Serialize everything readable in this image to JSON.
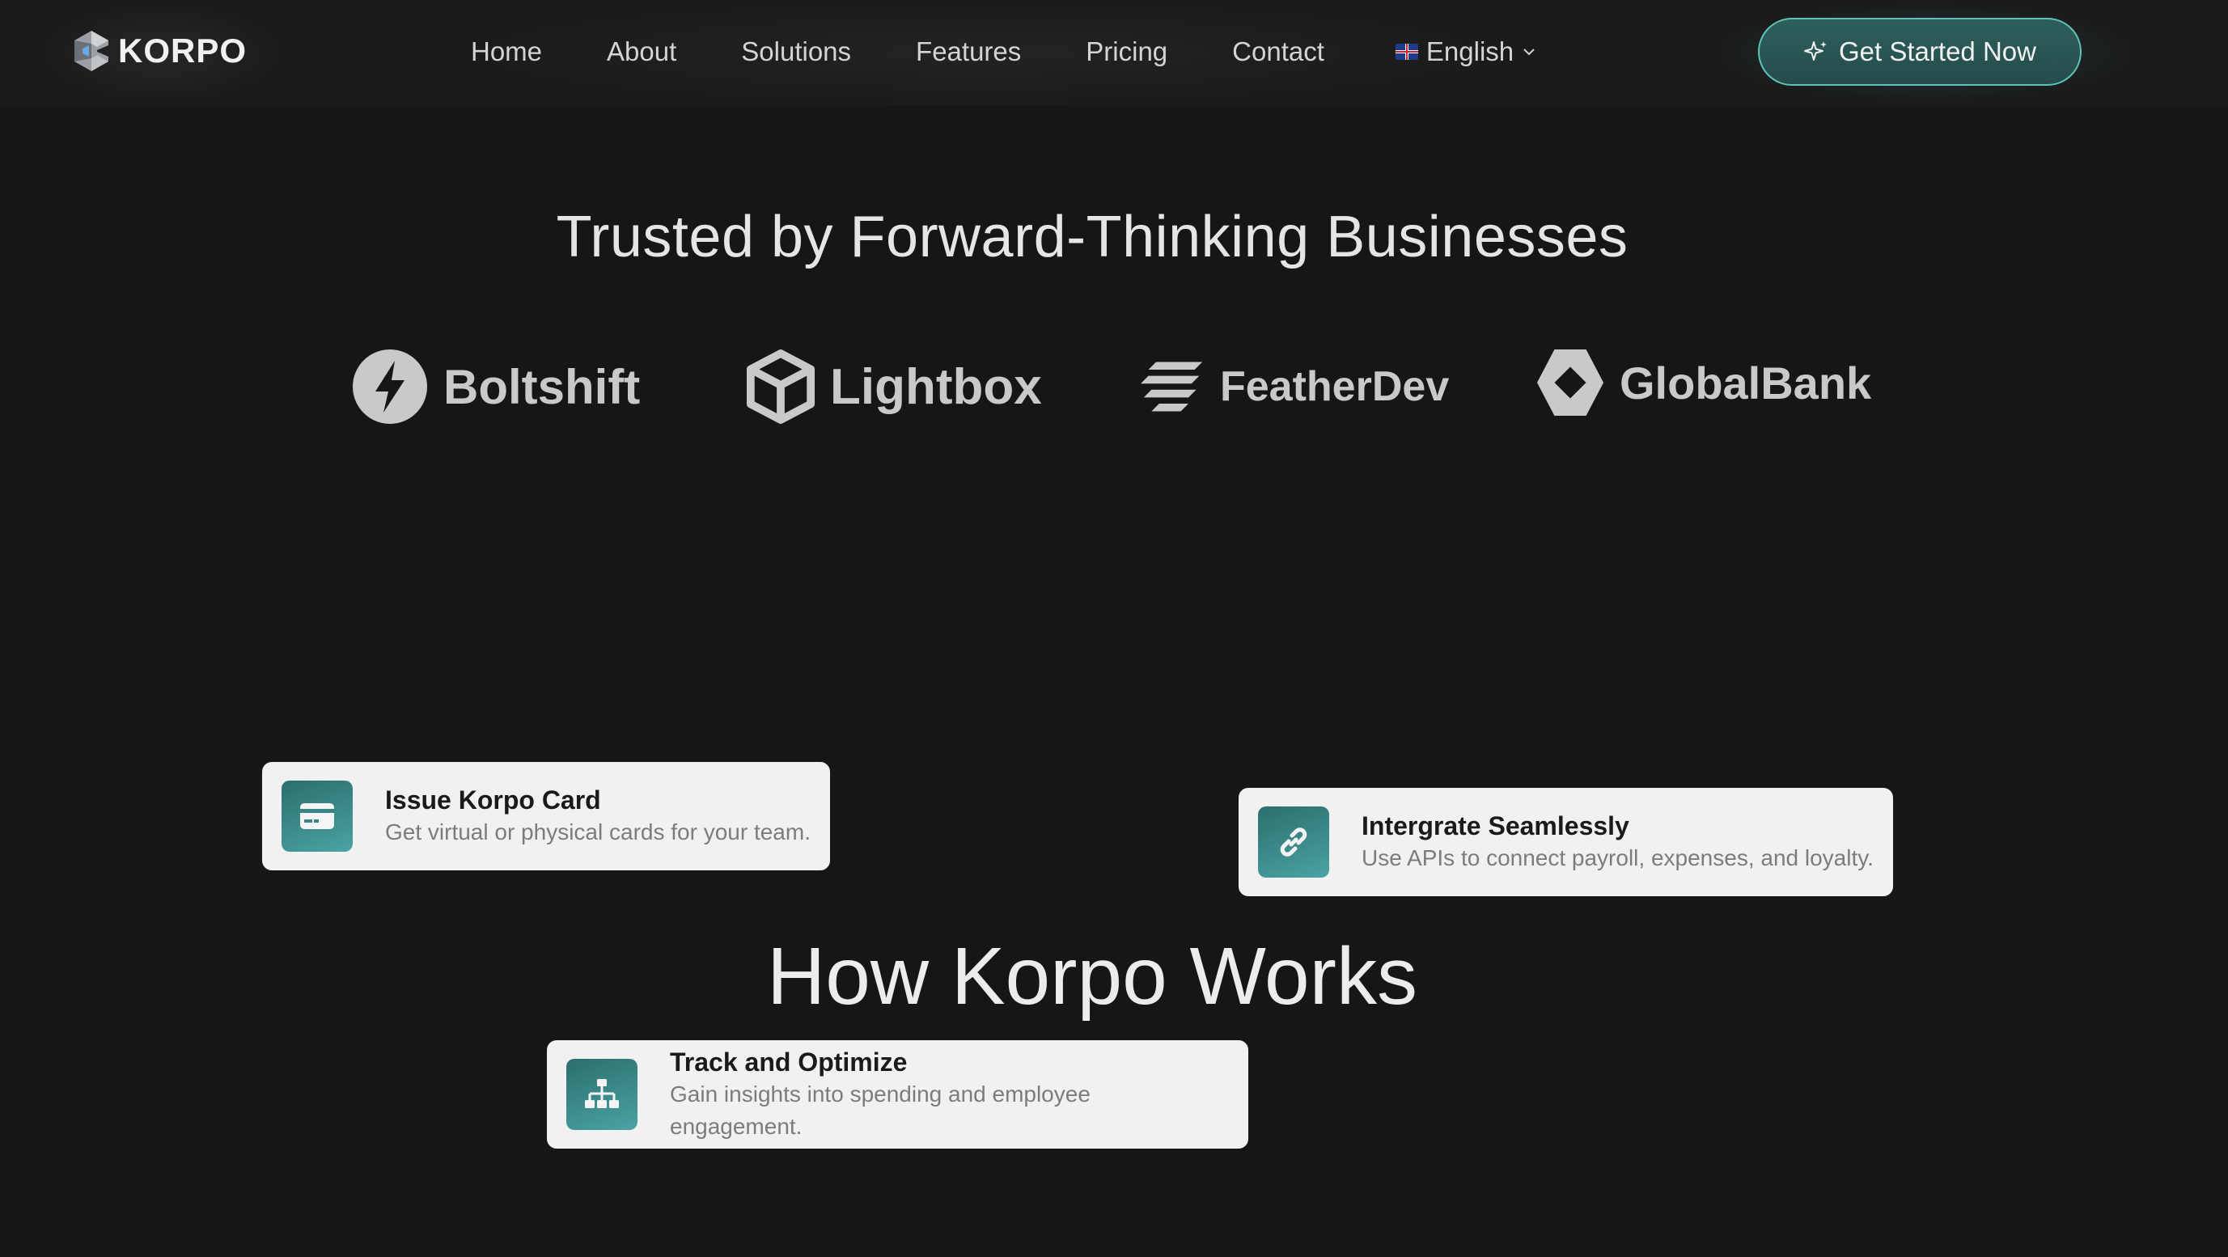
{
  "nav": {
    "brand": "KORPO",
    "links": [
      "Home",
      "About",
      "Solutions",
      "Features",
      "Pricing",
      "Contact"
    ],
    "language": "English",
    "cta": "Get Started Now"
  },
  "trusted": {
    "title": "Trusted by Forward-Thinking Businesses",
    "logos": [
      "Boltshift",
      "Lightbox",
      "FeatherDev",
      "GlobalBank"
    ]
  },
  "how": {
    "title": "How Korpo Works",
    "cards": [
      {
        "title": "Issue Korpo Card",
        "desc": "Get virtual or physical cards for your team.",
        "icon": "credit-card-icon"
      },
      {
        "title": "Intergrate Seamlessly",
        "desc": "Use APIs to connect payroll, expenses, and loyalty.",
        "icon": "link-icon"
      },
      {
        "title": "Track and Optimize",
        "desc": "Gain insights into spending and employee engagement.",
        "icon": "org-chart-icon"
      }
    ]
  },
  "colors": {
    "background": "#161616",
    "accent": "#4aa3a3",
    "cta_border": "#5ec3b6"
  }
}
